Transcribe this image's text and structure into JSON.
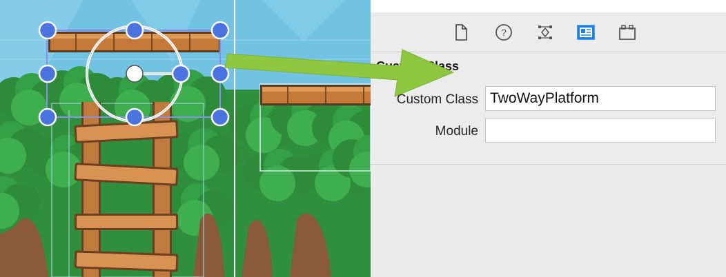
{
  "scene": {
    "node_name": "platform-node"
  },
  "inspector": {
    "tabs": [
      {
        "icon": "file-icon"
      },
      {
        "icon": "quick-help-icon"
      },
      {
        "icon": "identity-icon"
      },
      {
        "icon": "attributes-icon",
        "selected": true
      },
      {
        "icon": "size-icon"
      }
    ],
    "section_title": "Custom Class",
    "custom_class_label": "Custom Class",
    "custom_class_value": "TwoWayPlatform",
    "module_label": "Module",
    "module_value": ""
  },
  "colors": {
    "accent": "#1a82e2",
    "handle_blue": "#4a73e0",
    "arrow_green": "#8dc63f",
    "sky": "#6cc4e4",
    "leaf_dark": "#2e7d32",
    "leaf_mid": "#43a047",
    "wood": "#c8783a"
  }
}
